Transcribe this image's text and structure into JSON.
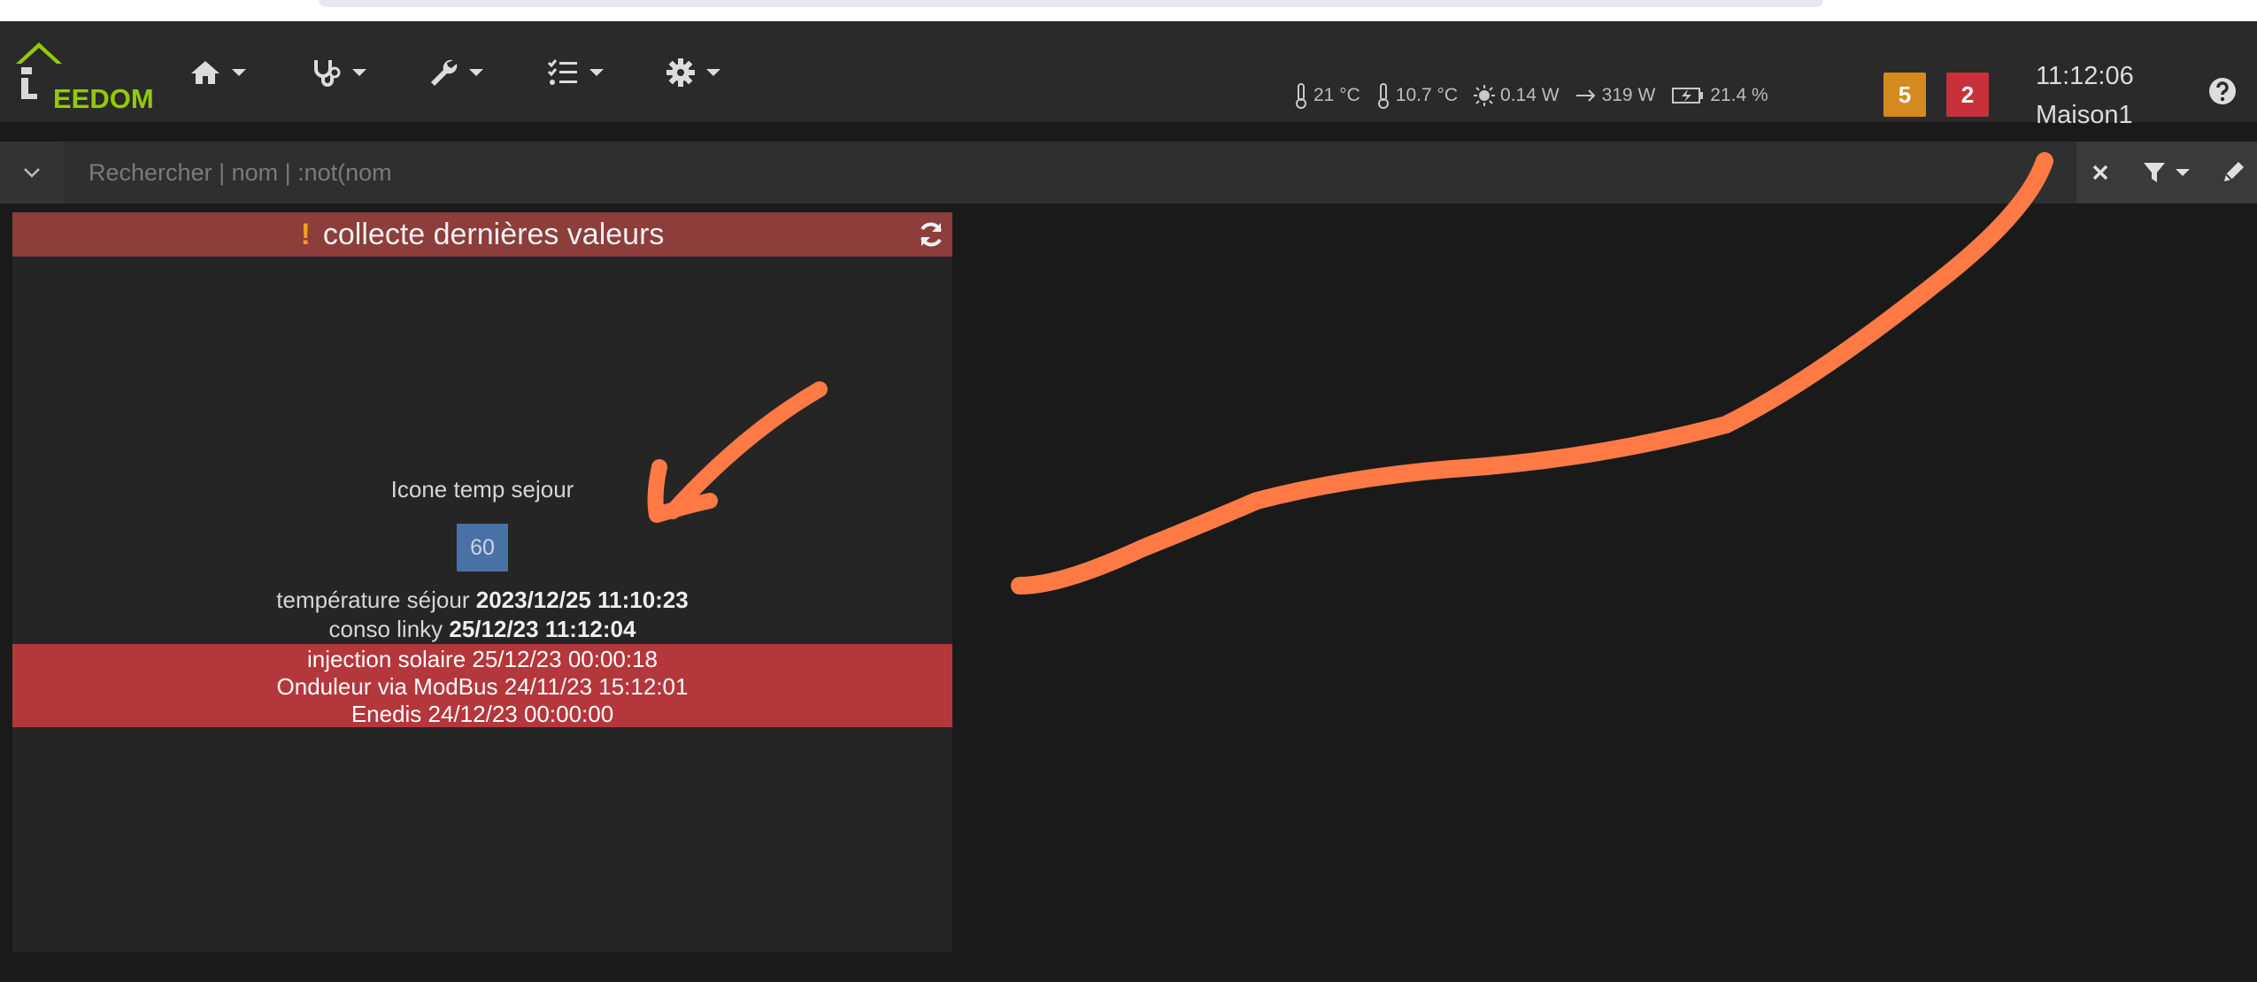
{
  "navbar": {
    "logo_text": "EEDOM",
    "menu": [
      {
        "name": "home",
        "icon": "home-icon"
      },
      {
        "name": "analysis",
        "icon": "stethoscope-icon"
      },
      {
        "name": "tools",
        "icon": "wrench-icon"
      },
      {
        "name": "plugins",
        "icon": "checklist-icon"
      },
      {
        "name": "settings",
        "icon": "gear-icon"
      }
    ],
    "status": {
      "temp_inside": "21 °C",
      "temp_outside": "10.7 °C",
      "solar_power": "0.14 W",
      "grid_power": "319 W",
      "battery": "21.4 %"
    },
    "badges": {
      "warning_count": "5",
      "alert_count": "2"
    },
    "clock": {
      "time": "11:12:06",
      "location": "Maison1"
    }
  },
  "search": {
    "placeholder": "Rechercher | nom | :not(nom"
  },
  "widget": {
    "title": "collecte dernières valeurs",
    "command_name": "Icone temp sejour",
    "command_value": "60",
    "lines": [
      {
        "label": "température séjour",
        "value": "2023/12/25 11:10:23"
      },
      {
        "label": "conso linky",
        "value": "25/12/23 11:12:04"
      }
    ],
    "alerts": [
      "injection solaire 25/12/23 00:00:18",
      "Onduleur via ModBus 24/11/23 15:12:01",
      "Enedis 24/12/23 00:00:00"
    ]
  },
  "colors": {
    "navbar_bg": "#2a2a2a",
    "widget_header": "#8d3d3a",
    "alert_bg": "#b4373b",
    "badge_orange": "#d48a1e",
    "badge_red": "#c8303a",
    "value_bg": "#4a71a6",
    "annotation": "#ff7a45",
    "logo_green": "#94ca02"
  }
}
